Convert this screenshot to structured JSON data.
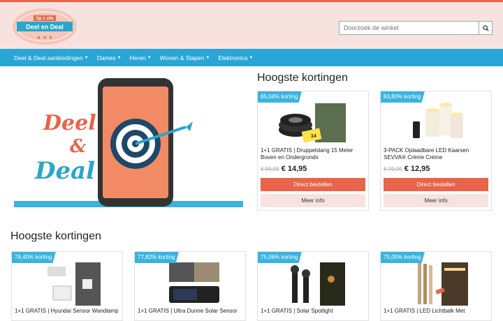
{
  "header": {
    "logo": {
      "ribbon": "Op 1 site",
      "name": "Deel en Deal",
      "arc_text": ""
    },
    "search": {
      "placeholder": "Doorzoek de winkel"
    }
  },
  "nav": [
    {
      "label": "Deel & Deal aanbiedingen"
    },
    {
      "label": "Dames"
    },
    {
      "label": "Heren"
    },
    {
      "label": "Wonen & Slapen"
    },
    {
      "label": "Elektronica"
    }
  ],
  "hero": {
    "word1": "Deel",
    "amp": "&",
    "word2": "Deal"
  },
  "top_section": {
    "title": "Hoogste kortingen",
    "cards": [
      {
        "badge": "85,04% korting",
        "title": "1+1 GRATIS | Druppelslang 15 Meter Boven en Ondergronds",
        "old_price": "€ 99,95",
        "new_price": "€ 14,95",
        "order_label": "Direct bestellen",
        "info_label": "Meer info",
        "img_tag": "14"
      },
      {
        "badge": "83,80% korting",
        "title": "3-PACK Oplaadbare LED Kaarsen SEVVA® Crème Crème",
        "old_price": "€ 79,95",
        "new_price": "€ 12,95",
        "order_label": "Direct bestellen",
        "info_label": "Meer info"
      }
    ]
  },
  "bottom_section": {
    "title": "Hoogste kortingen",
    "cards": [
      {
        "badge": "78,40% korting",
        "title": "1+1 GRATIS | Hyundai Sensor Wandlamp"
      },
      {
        "badge": "77,82% korting",
        "title": "1+1 GRATIS | Ultra Dunne Solar Sensor"
      },
      {
        "badge": "75,06% korting",
        "title": "1+1 GRATIS | Solar Spotlight"
      },
      {
        "badge": "75,05% korting",
        "title": "1+1 GRATIS | LED Lichtbalk Met"
      }
    ]
  },
  "colors": {
    "accent": "#e8644a",
    "nav": "#2aa6d6",
    "header_bg": "#f6e3df",
    "badge": "#3ab4df"
  }
}
